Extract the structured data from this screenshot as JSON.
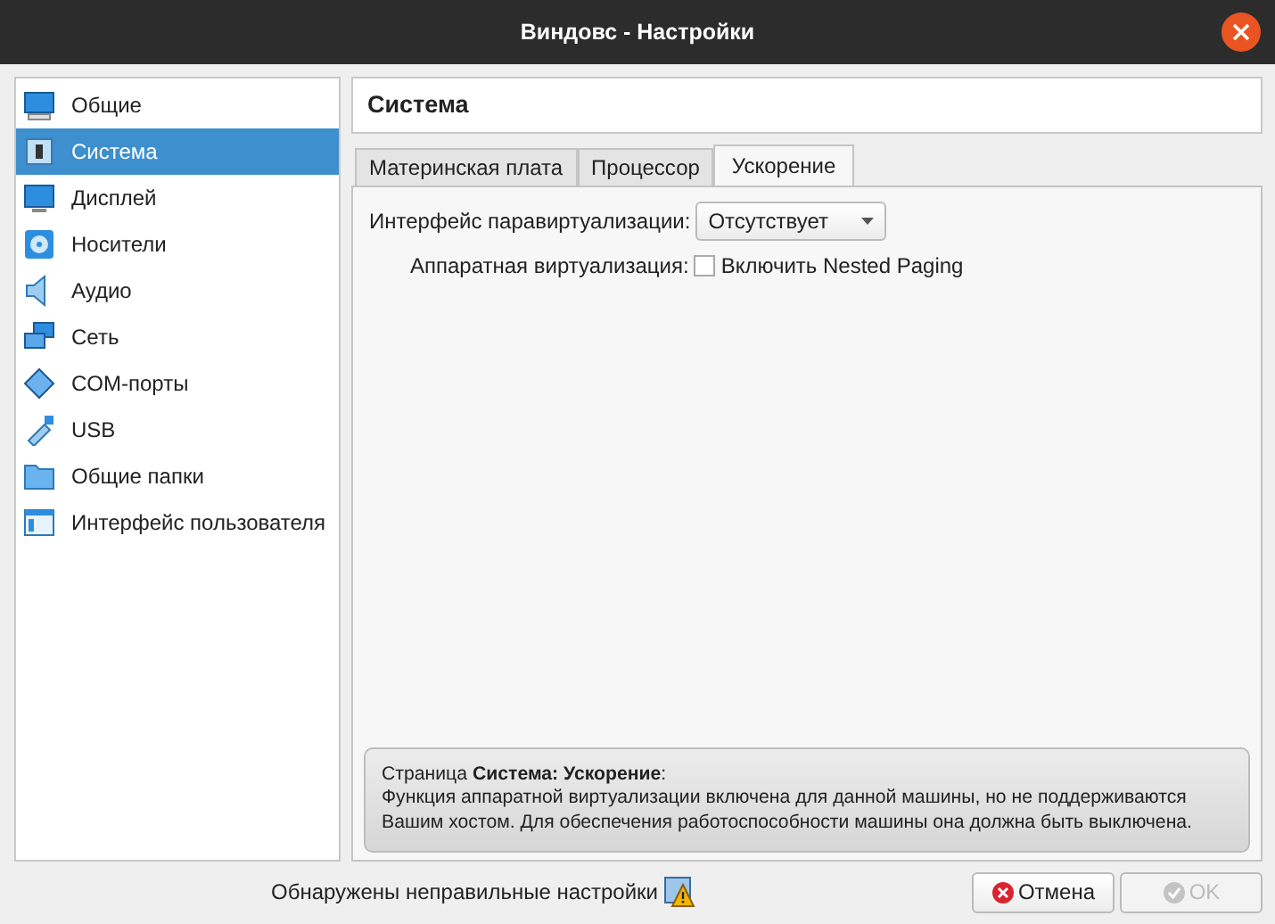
{
  "window": {
    "title": "Виндовс - Настройки"
  },
  "sidebar": {
    "items": [
      {
        "label": "Общие",
        "selected": false
      },
      {
        "label": "Система",
        "selected": true
      },
      {
        "label": "Дисплей",
        "selected": false
      },
      {
        "label": "Носители",
        "selected": false
      },
      {
        "label": "Аудио",
        "selected": false
      },
      {
        "label": "Сеть",
        "selected": false
      },
      {
        "label": "COM-порты",
        "selected": false
      },
      {
        "label": "USB",
        "selected": false
      },
      {
        "label": "Общие папки",
        "selected": false
      },
      {
        "label": "Интерфейс пользователя",
        "selected": false
      }
    ]
  },
  "page_title": "Система",
  "tabs": [
    {
      "label": "Материнская плата",
      "selected": false
    },
    {
      "label": "Процессор",
      "selected": false
    },
    {
      "label": "Ускорение",
      "selected": true
    }
  ],
  "paravirt": {
    "label": "Интерфейс паравиртуализации:",
    "value": "Отсутствует"
  },
  "hwvirt": {
    "label": "Аппаратная виртуализация:",
    "checkbox_label": "Включить Nested Paging",
    "checked": false
  },
  "info": {
    "heading": "Страница **Система: Ускорение**:",
    "text": "Функция аппаратной виртуализации включена для данной машины, но не поддерживаются Вашим хостом. Для обеспечения работоспособности машины она должна быть выключена."
  },
  "status": "Обнаружены неправильные настройки",
  "buttons": [
    {
      "label": "Отмена",
      "kind": "cancel",
      "disabled": false
    },
    {
      "label": "OK",
      "kind": "ok",
      "disabled": true
    }
  ]
}
